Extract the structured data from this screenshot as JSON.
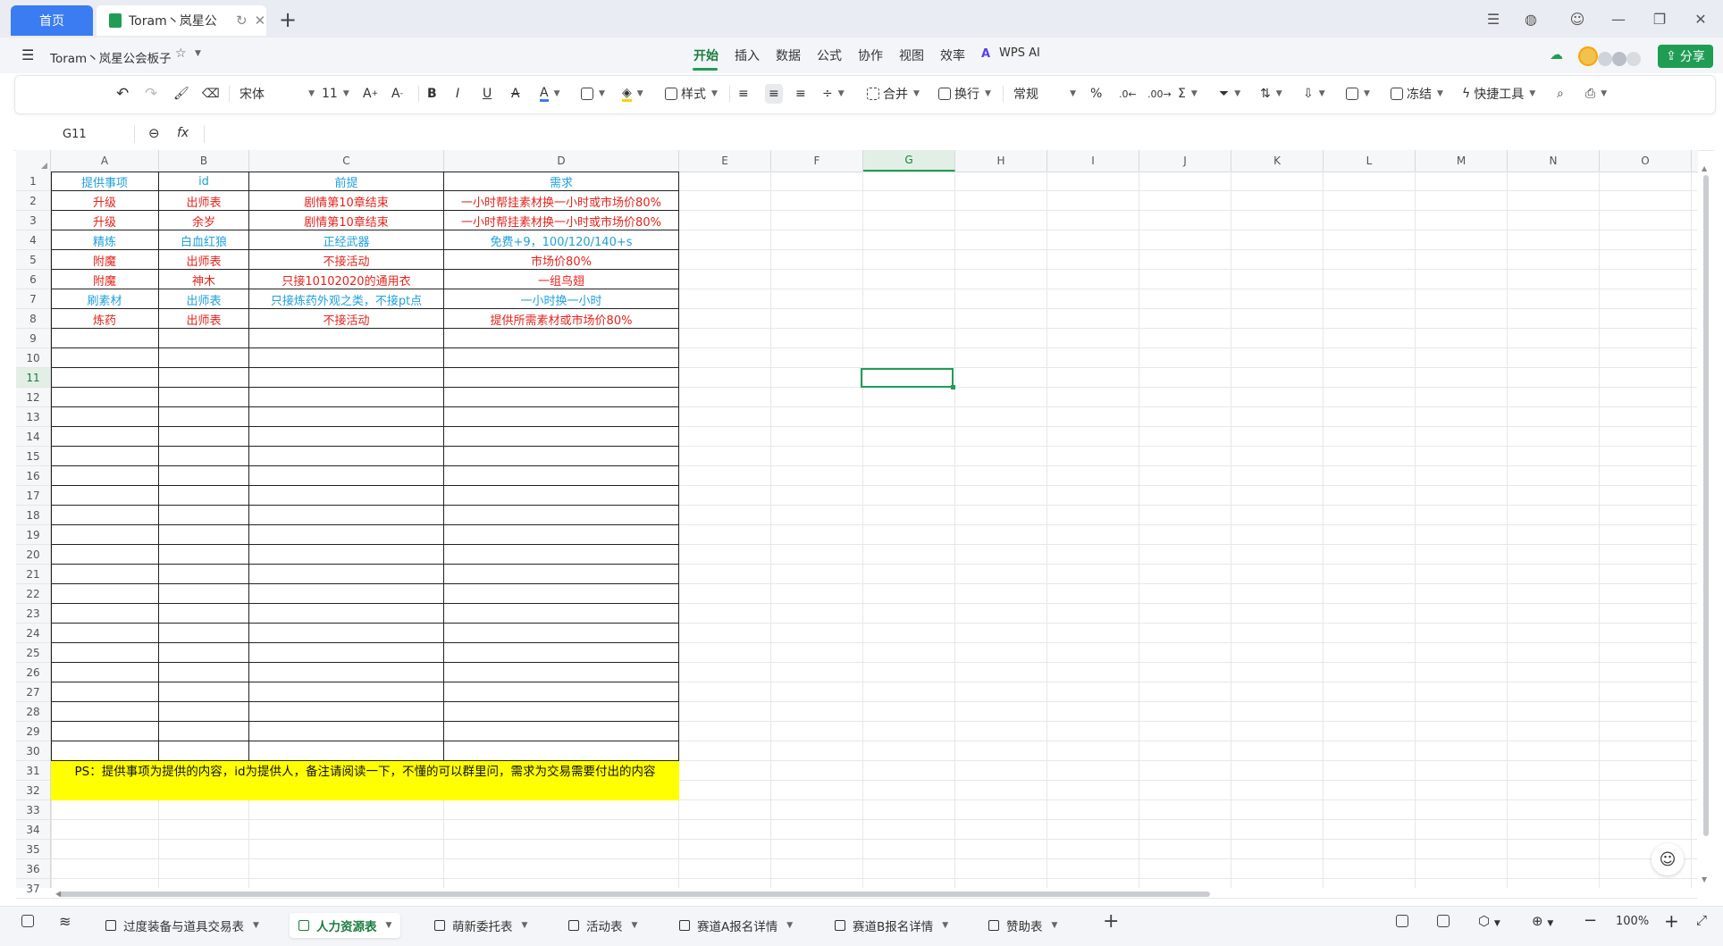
{
  "titlebar": {
    "home_tab": "首页",
    "doc_tab_title": "Toram丶岚星公",
    "new_tab": "+"
  },
  "menu": {
    "doc_name": "Toram丶岚星公会板子",
    "items": [
      "开始",
      "插入",
      "数据",
      "公式",
      "协作",
      "视图",
      "效率"
    ],
    "wps_ai": "WPS AI",
    "share": "分享"
  },
  "toolbar": {
    "font_name": "宋体",
    "font_size": "11",
    "style": "样式",
    "merge": "合并",
    "wrap": "换行",
    "number_format": "常规",
    "freeze": "冻结",
    "quick_tools": "快捷工具"
  },
  "formula_bar": {
    "cell_ref": "G11",
    "fx": "fx",
    "value": ""
  },
  "grid": {
    "columns": [
      "A",
      "B",
      "C",
      "D",
      "E",
      "F",
      "G",
      "H",
      "I",
      "J",
      "K",
      "L",
      "M",
      "N",
      "O"
    ],
    "selected_col": "G",
    "selected_row": 11,
    "row_count": 37,
    "header_row": [
      "提供事项",
      "id",
      "前提",
      "需求"
    ],
    "rows": [
      [
        "升级",
        "出师表",
        "剧情第10章结束",
        "一小时帮挂素材换一小时或市场价80%"
      ],
      [
        "升级",
        "余岁",
        "剧情第10章结束",
        "一小时帮挂素材换一小时或市场价80%"
      ],
      [
        "精炼",
        "白血红狼",
        "正经武器",
        "免费+9，100/120/140+s"
      ],
      [
        "附魔",
        "出师表",
        "不接活动",
        "市场价80%"
      ],
      [
        "附魔",
        "神木",
        "只接10102020的通用衣",
        "一组鸟翅"
      ],
      [
        "刷素材",
        "出师表",
        "只接炼药外观之类，不接pt点",
        "一小时换一小时"
      ],
      [
        "炼药",
        "出师表",
        "不接活动",
        "提供所需素材或市场价80%"
      ]
    ],
    "row_colors": [
      "#e8231c",
      "#e8231c",
      "#1fa1de",
      "#e8231c",
      "#e8231c",
      "#1fa1de",
      "#e8231c"
    ],
    "header_color": "#1fa1de",
    "note": "PS：提供事项为提供的内容，id为提供人，备注请阅读一下，不懂的可以群里问，需求为交易需要付出的内容",
    "note_bg": "#ffff00"
  },
  "sheets": {
    "tabs": [
      "过度装备与道具交易表",
      "人力资源表",
      "萌新委托表",
      "活动表",
      "赛道A报名详情",
      "赛道B报名详情",
      "赞助表"
    ],
    "active": "人力资源表"
  },
  "status": {
    "zoom": "100%"
  },
  "colors": {
    "accent": "#1f9d55",
    "tab_blue": "#3b7cf2"
  }
}
